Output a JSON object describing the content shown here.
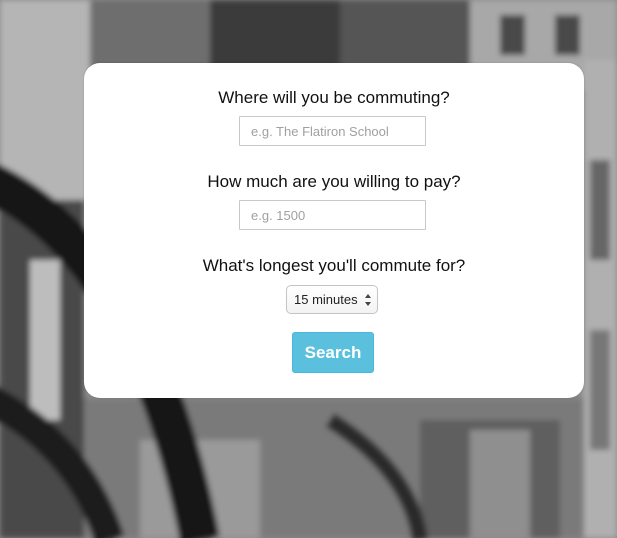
{
  "form": {
    "commute_question": "Where will you be commuting?",
    "commute_placeholder": "e.g. The Flatiron School",
    "commute_value": "",
    "pay_question": "How much are you willing to pay?",
    "pay_placeholder": "e.g. 1500",
    "pay_value": "",
    "duration_question": "What's longest you'll commute for?",
    "duration_selected": "15 minutes",
    "search_label": "Search"
  },
  "colors": {
    "search_button": "#5bc0de",
    "card_background": "#ffffff"
  },
  "icons": {
    "select_arrows": "updown-chevron-icon"
  }
}
